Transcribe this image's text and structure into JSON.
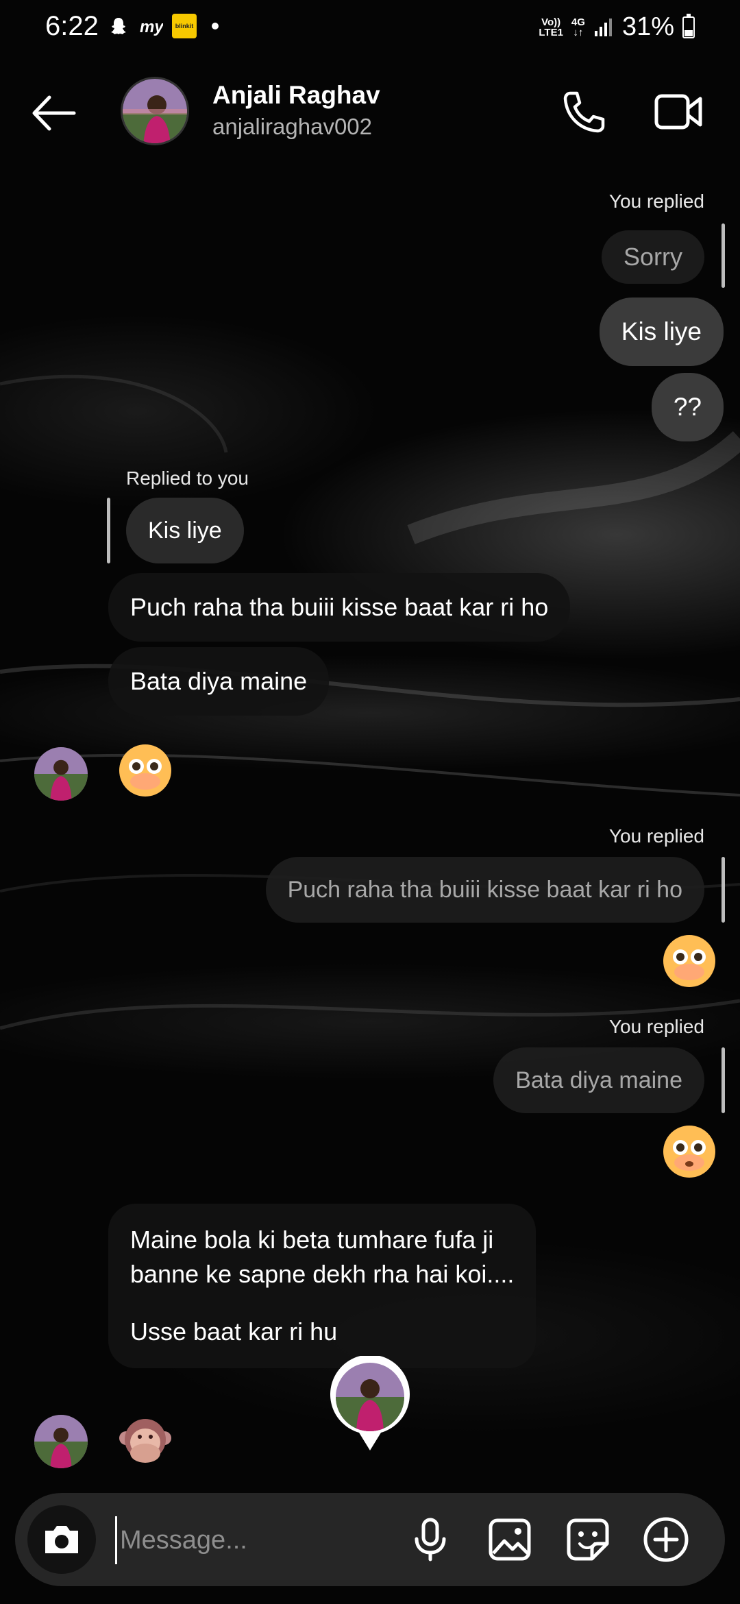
{
  "status_bar": {
    "time": "6:22",
    "network_top": "Vo))",
    "network_bottom": "LTE1",
    "network_gen": "4G",
    "battery": "31%",
    "blinkit_label": "blinkit"
  },
  "header": {
    "name": "Anjali Raghav",
    "username": "anjaliraghav002",
    "icons": [
      "back-arrow-icon",
      "phone-icon",
      "video-camera-icon"
    ]
  },
  "messages": {
    "m1_label": "You replied",
    "m1_quote": "Sorry",
    "m2": "Kis liye",
    "m3": "??",
    "m4_label": "Replied to you",
    "m4_quote": "Kis liye",
    "m5": "Puch raha tha buiii kisse baat kar ri ho",
    "m6": "Bata diya maine",
    "m7_emoji": "flushed-face-emoji",
    "m8_label": "You replied",
    "m8_quote": "Puch raha tha buiii kisse baat kar ri ho",
    "m9_emoji": "flushed-face-emoji",
    "m10_label": "You replied",
    "m10_quote": "Bata diya maine",
    "m11_emoji": "flushed-face-emoji",
    "m12_line1": "Maine bola ki beta tumhare fufa ji",
    "m12_line2": "banne ke sapne dekh rha hai koi....",
    "m12_line3": "Usse baat kar ri hu",
    "m13_emoji": "speak-no-evil-monkey-emoji"
  },
  "composer": {
    "placeholder": "Message...",
    "icons": [
      "camera-icon",
      "microphone-icon",
      "gallery-icon",
      "sticker-icon",
      "plus-icon"
    ]
  },
  "colors": {
    "background": "#050505",
    "my_bubble": "#3b3b3b",
    "their_bubble": "#121212",
    "composer": "#262626"
  }
}
